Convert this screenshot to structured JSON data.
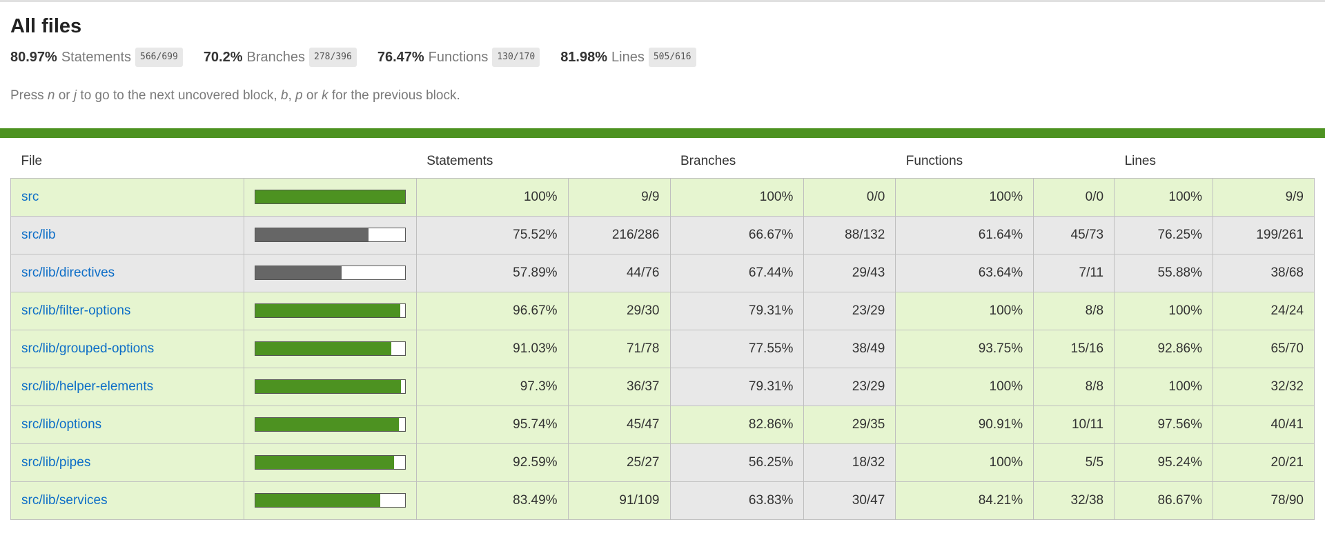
{
  "title": "All files",
  "summary": [
    {
      "pct": "80.97%",
      "label": "Statements",
      "frac": "566/699"
    },
    {
      "pct": "70.2%",
      "label": "Branches",
      "frac": "278/396"
    },
    {
      "pct": "76.47%",
      "label": "Functions",
      "frac": "130/170"
    },
    {
      "pct": "81.98%",
      "label": "Lines",
      "frac": "505/616"
    }
  ],
  "help": {
    "press": "Press",
    "n": "n",
    "or1": "or",
    "j": "j",
    "next": "to go to the next uncovered block,",
    "b": "b",
    "comma": ",",
    "p": "p",
    "or2": "or",
    "k": "k",
    "prev": "for the previous block."
  },
  "colors": {
    "high": "#4d9221",
    "low": "#666666",
    "high_bg": "#e6f5d0",
    "low_bg": "#e8e8e8",
    "link": "#0d6ec7"
  },
  "table": {
    "headers": {
      "file": "File",
      "statements": "Statements",
      "branches": "Branches",
      "functions": "Functions",
      "lines": "Lines"
    },
    "rows": [
      {
        "file": "src",
        "fill": 1.0,
        "bar": "high",
        "s_pct": "100%",
        "s_frac": "9/9",
        "s_cls": "high",
        "b_pct": "100%",
        "b_frac": "0/0",
        "b_cls": "high",
        "f_pct": "100%",
        "f_frac": "0/0",
        "f_cls": "high",
        "l_pct": "100%",
        "l_frac": "9/9",
        "l_cls": "high"
      },
      {
        "file": "src/lib",
        "fill": 0.7552,
        "bar": "low",
        "s_pct": "75.52%",
        "s_frac": "216/286",
        "s_cls": "low",
        "b_pct": "66.67%",
        "b_frac": "88/132",
        "b_cls": "low",
        "f_pct": "61.64%",
        "f_frac": "45/73",
        "f_cls": "low",
        "l_pct": "76.25%",
        "l_frac": "199/261",
        "l_cls": "low"
      },
      {
        "file": "src/lib/directives",
        "fill": 0.5789,
        "bar": "low",
        "s_pct": "57.89%",
        "s_frac": "44/76",
        "s_cls": "low",
        "b_pct": "67.44%",
        "b_frac": "29/43",
        "b_cls": "low",
        "f_pct": "63.64%",
        "f_frac": "7/11",
        "f_cls": "low",
        "l_pct": "55.88%",
        "l_frac": "38/68",
        "l_cls": "low"
      },
      {
        "file": "src/lib/filter-options",
        "fill": 0.9667,
        "bar": "high",
        "s_pct": "96.67%",
        "s_frac": "29/30",
        "s_cls": "high",
        "b_pct": "79.31%",
        "b_frac": "23/29",
        "b_cls": "low",
        "f_pct": "100%",
        "f_frac": "8/8",
        "f_cls": "high",
        "l_pct": "100%",
        "l_frac": "24/24",
        "l_cls": "high"
      },
      {
        "file": "src/lib/grouped-options",
        "fill": 0.9103,
        "bar": "high",
        "s_pct": "91.03%",
        "s_frac": "71/78",
        "s_cls": "high",
        "b_pct": "77.55%",
        "b_frac": "38/49",
        "b_cls": "low",
        "f_pct": "93.75%",
        "f_frac": "15/16",
        "f_cls": "high",
        "l_pct": "92.86%",
        "l_frac": "65/70",
        "l_cls": "high"
      },
      {
        "file": "src/lib/helper-elements",
        "fill": 0.973,
        "bar": "high",
        "s_pct": "97.3%",
        "s_frac": "36/37",
        "s_cls": "high",
        "b_pct": "79.31%",
        "b_frac": "23/29",
        "b_cls": "low",
        "f_pct": "100%",
        "f_frac": "8/8",
        "f_cls": "high",
        "l_pct": "100%",
        "l_frac": "32/32",
        "l_cls": "high"
      },
      {
        "file": "src/lib/options",
        "fill": 0.9574,
        "bar": "high",
        "s_pct": "95.74%",
        "s_frac": "45/47",
        "s_cls": "high",
        "b_pct": "82.86%",
        "b_frac": "29/35",
        "b_cls": "high",
        "f_pct": "90.91%",
        "f_frac": "10/11",
        "f_cls": "high",
        "l_pct": "97.56%",
        "l_frac": "40/41",
        "l_cls": "high"
      },
      {
        "file": "src/lib/pipes",
        "fill": 0.9259,
        "bar": "high",
        "s_pct": "92.59%",
        "s_frac": "25/27",
        "s_cls": "high",
        "b_pct": "56.25%",
        "b_frac": "18/32",
        "b_cls": "low",
        "f_pct": "100%",
        "f_frac": "5/5",
        "f_cls": "high",
        "l_pct": "95.24%",
        "l_frac": "20/21",
        "l_cls": "high"
      },
      {
        "file": "src/lib/services",
        "fill": 0.8349,
        "bar": "high",
        "s_pct": "83.49%",
        "s_frac": "91/109",
        "s_cls": "high",
        "b_pct": "63.83%",
        "b_frac": "30/47",
        "b_cls": "low",
        "f_pct": "84.21%",
        "f_frac": "32/38",
        "f_cls": "high",
        "l_pct": "86.67%",
        "l_frac": "78/90",
        "l_cls": "high"
      }
    ]
  }
}
